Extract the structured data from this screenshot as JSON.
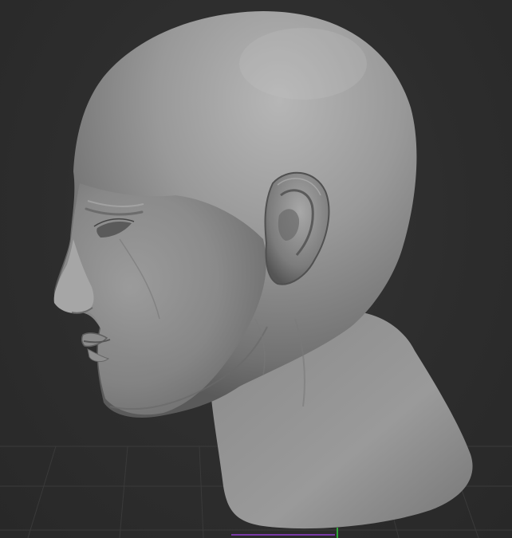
{
  "viewport": {
    "background_color": "#2c2c2c",
    "grid_color": "#3a3a3a",
    "model_base_color": "#8e8e8e",
    "model": "head-bust-sculpt-icon",
    "axis_x_color": "#7a3aa8",
    "axis_y_color": "#2fa83a"
  }
}
